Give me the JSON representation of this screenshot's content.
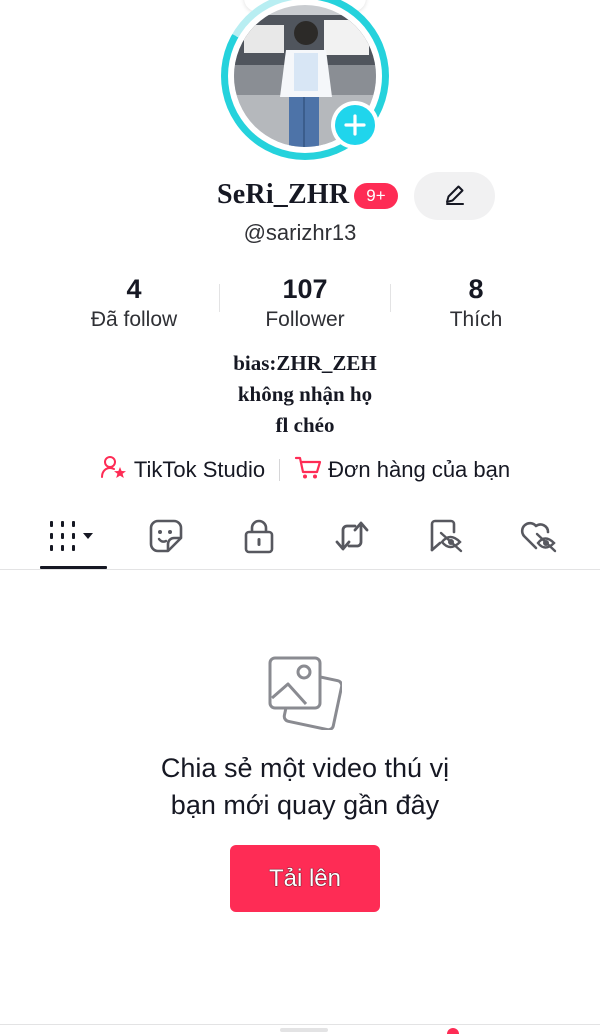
{
  "profile": {
    "display_name": "SeRi_ZHR",
    "notification_badge": "9+",
    "handle": "@sarizhr13"
  },
  "stats": [
    {
      "value": "4",
      "label": "Đã follow"
    },
    {
      "value": "107",
      "label": "Follower"
    },
    {
      "value": "8",
      "label": "Thích"
    }
  ],
  "bio": {
    "line1": "bias:ZHR_ZEH",
    "line2": "không nhận họ",
    "line3": "fl chéo"
  },
  "links": {
    "studio_label": "TikTok Studio",
    "orders_label": "Đơn hàng của bạn"
  },
  "tabs": [
    {
      "icon": "videos-grid-icon",
      "active": true
    },
    {
      "icon": "sticker-icon"
    },
    {
      "icon": "lock-icon"
    },
    {
      "icon": "repost-icon"
    },
    {
      "icon": "favorites-icon"
    },
    {
      "icon": "liked-icon"
    }
  ],
  "empty_state": {
    "icon": "photos-icon",
    "line1": "Chia sẻ một video thú vị",
    "line2": "bạn mới quay gần đây",
    "upload_label": "Tải lên"
  },
  "colors": {
    "accent": "#fe2c55",
    "ring": "#25d2dc",
    "text": "#161823"
  }
}
